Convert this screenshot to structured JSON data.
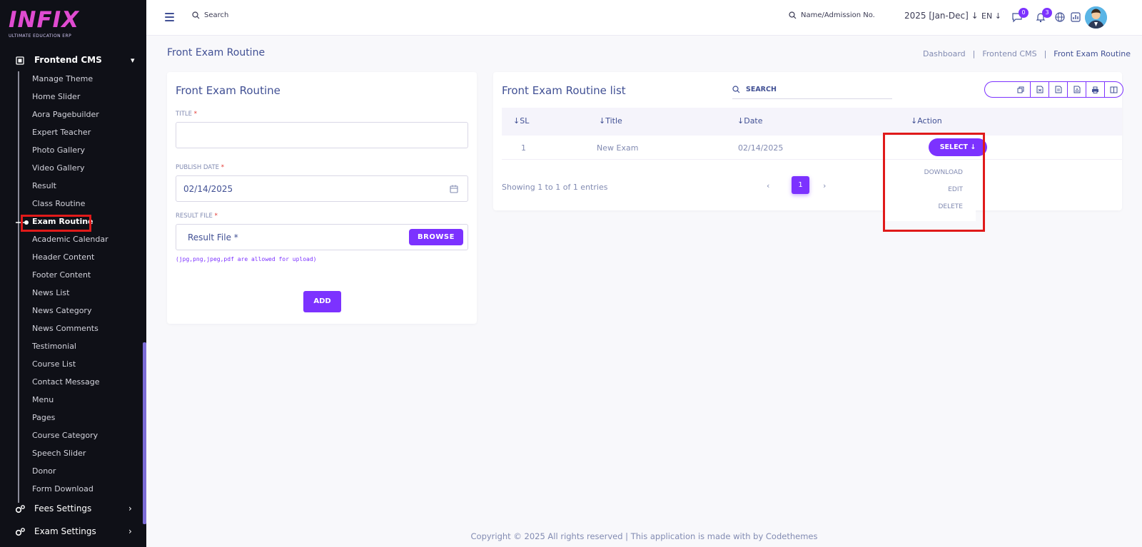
{
  "brand": {
    "logo": "INFIX",
    "tagline": "ULTIMATE EDUCATION ERP"
  },
  "sidebar": {
    "section": "Frontend CMS",
    "items": [
      "Manage Theme",
      "Home Slider",
      "Aora Pagebuilder",
      "Expert Teacher",
      "Photo Gallery",
      "Video Gallery",
      "Result",
      "Class Routine",
      "Exam Routine",
      "Academic Calendar",
      "Header Content",
      "Footer Content",
      "News List",
      "News Category",
      "News Comments",
      "Testimonial",
      "Course List",
      "Contact Message",
      "Menu",
      "Pages",
      "Course Category",
      "Speech Slider",
      "Donor",
      "Form Download"
    ],
    "active": "Exam Routine",
    "bottom": [
      "Fees Settings",
      "Exam Settings"
    ]
  },
  "header": {
    "search_placeholder": "Search",
    "name_search": "Name/Admission No.",
    "year": "2025 [Jan-Dec]",
    "lang": "EN",
    "messages_count": "0",
    "notifications_count": "3"
  },
  "page": {
    "title": "Front Exam Routine",
    "breadcrumb": [
      "Dashboard",
      "Frontend CMS",
      "Front Exam Routine"
    ]
  },
  "form": {
    "title": "Front Exam Routine",
    "title_label": "TITLE",
    "publish_label": "PUBLISH DATE",
    "publish_value": "02/14/2025",
    "file_label": "RESULT FILE",
    "file_placeholder": "Result File *",
    "browse": "BROWSE",
    "hint": "(jpg,png,jpeg,pdf are allowed for upload)",
    "add": "ADD",
    "required": "*"
  },
  "list": {
    "title": "Front Exam Routine list",
    "search": "SEARCH",
    "columns": [
      "SL",
      "Title",
      "Date",
      "Action"
    ],
    "rows": [
      {
        "sl": "1",
        "title": "New Exam",
        "date": "02/14/2025"
      }
    ],
    "select": "SELECT",
    "dropdown": [
      "DOWNLOAD",
      "EDIT",
      "DELETE"
    ],
    "showing": "Showing 1 to 1 of 1 entries",
    "page": "1"
  },
  "footer": "Copyright © 2025 All rights reserved | This application is made with by Codethemes",
  "colors": {
    "accent": "#7c32ff",
    "sidebar": "#0f1017",
    "text": "#415094",
    "highlight": "#e01a1a"
  }
}
